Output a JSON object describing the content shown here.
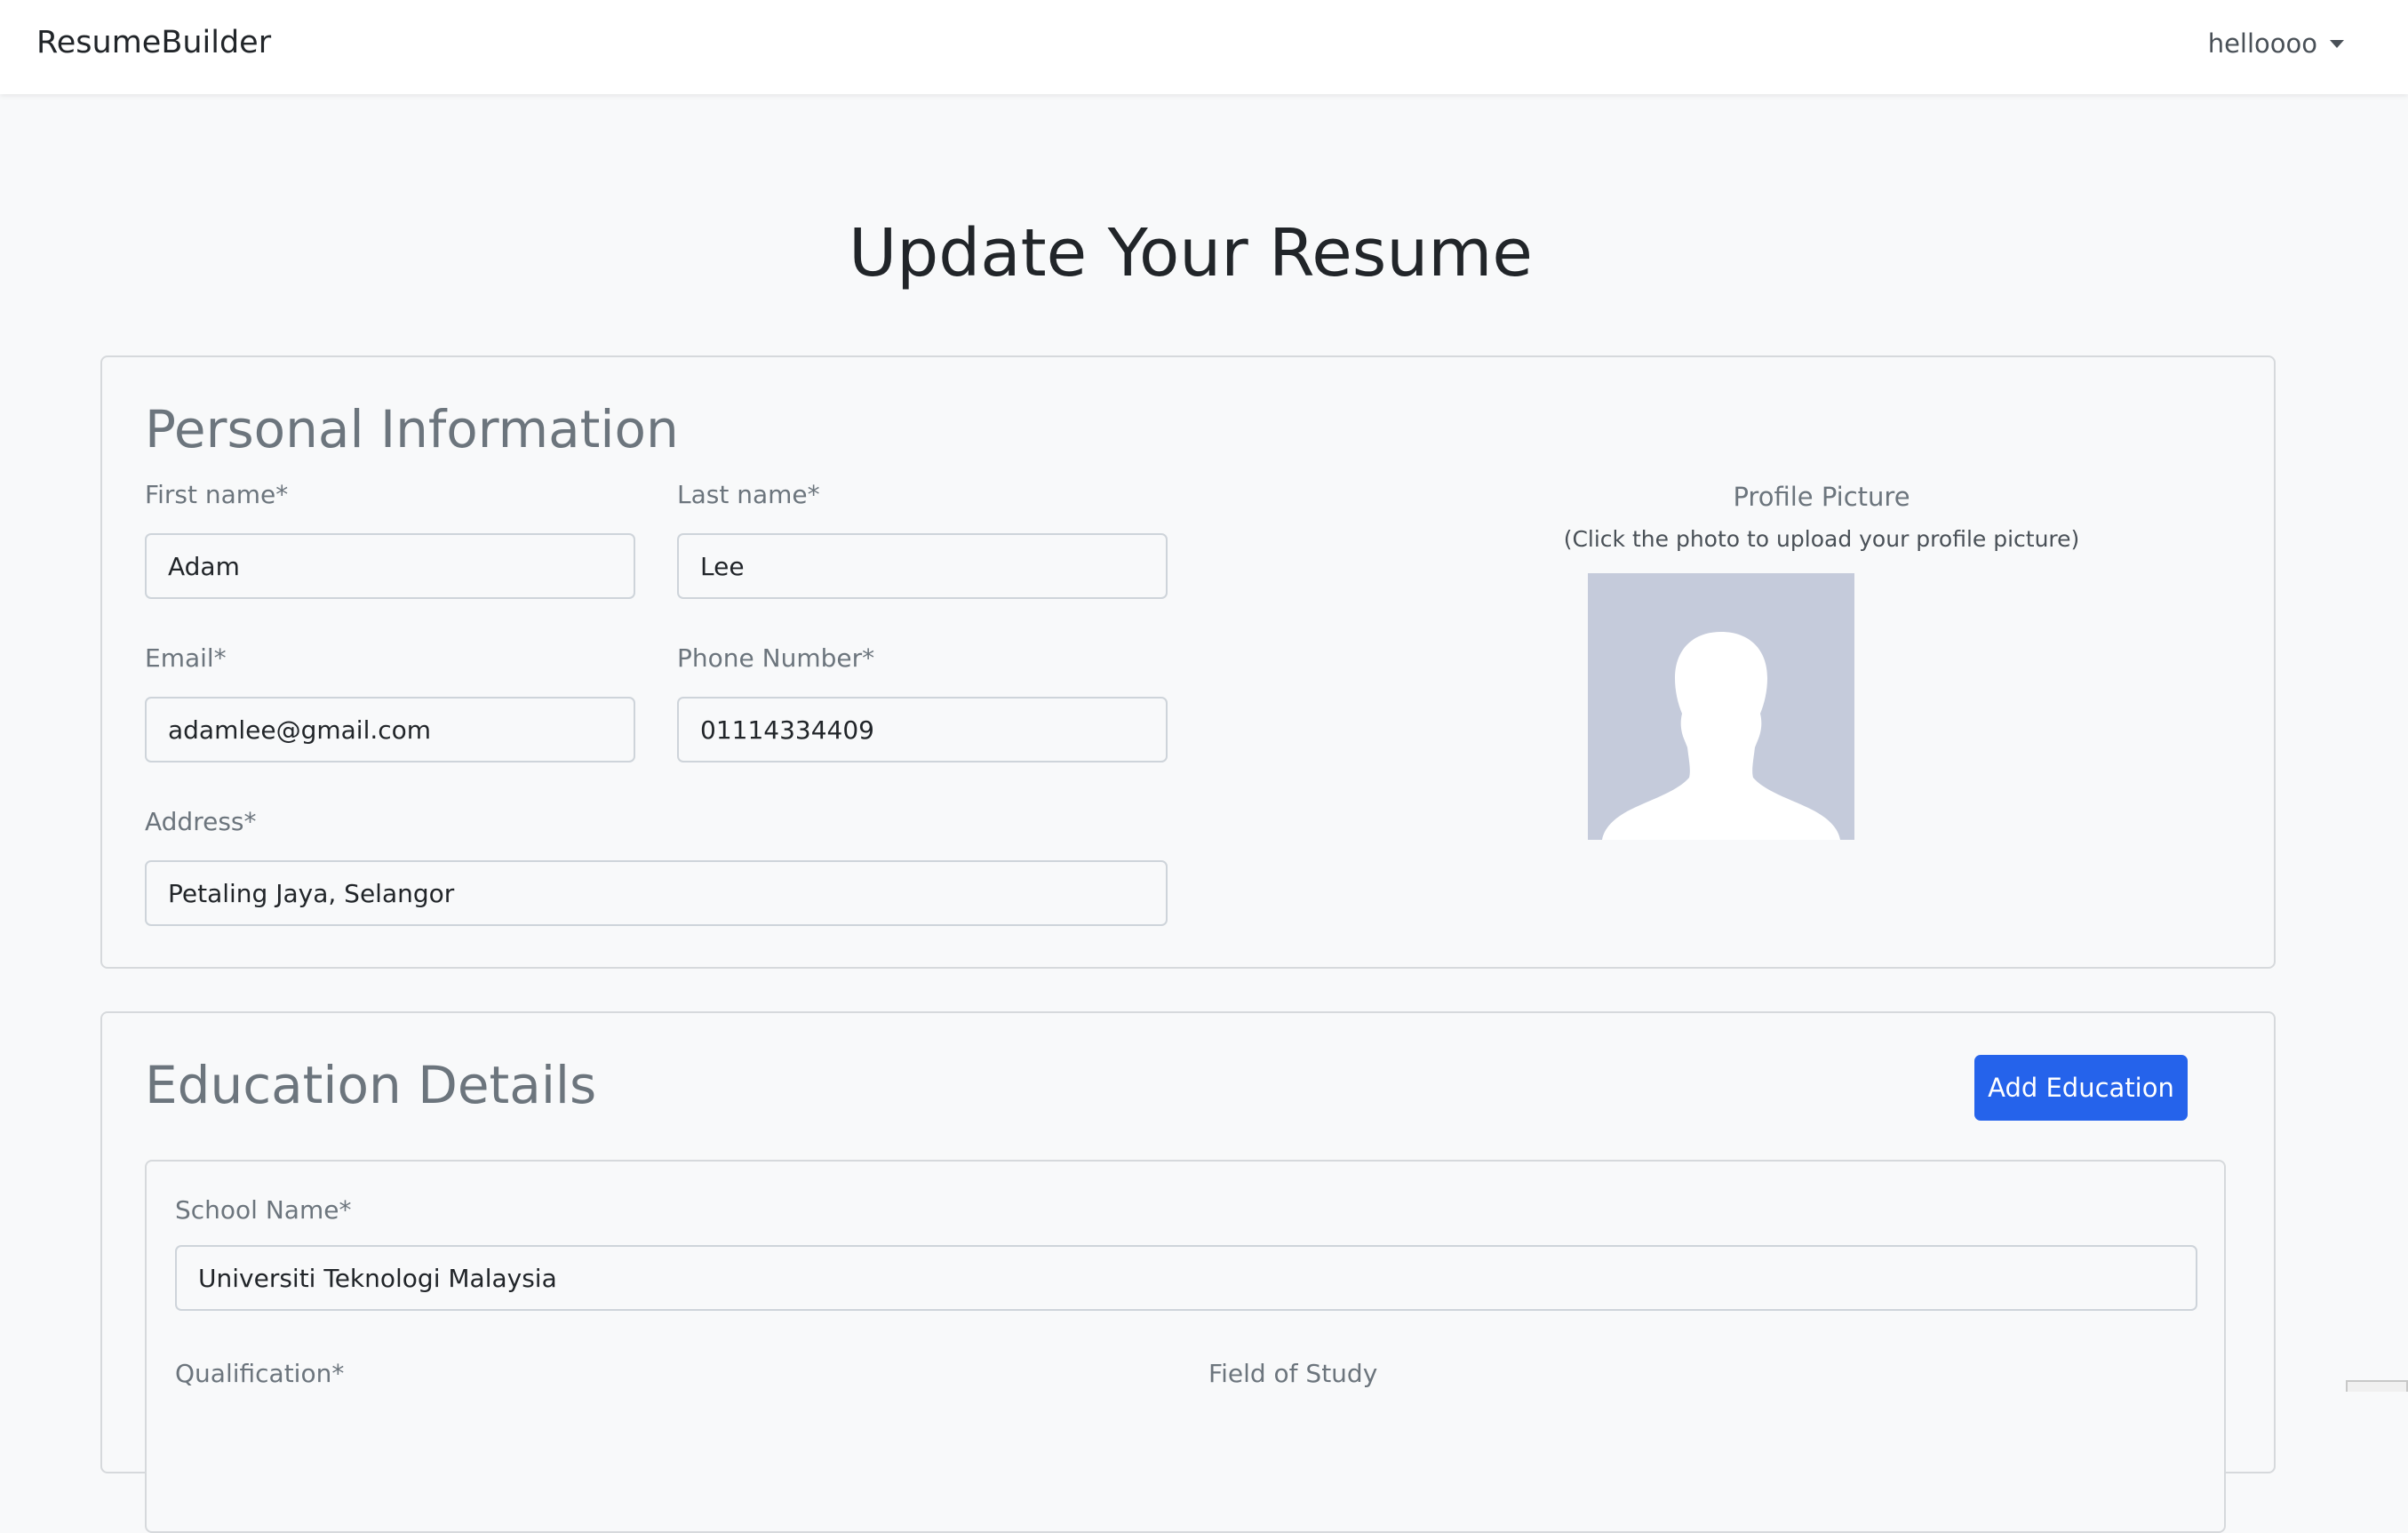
{
  "navbar": {
    "brand": "ResumeBuilder",
    "user_name": "helloooo"
  },
  "page_title": "Update Your Resume",
  "personal": {
    "title": "Personal Information",
    "first_name": {
      "label": "First name*",
      "value": "Adam"
    },
    "last_name": {
      "label": "Last name*",
      "value": "Lee"
    },
    "email": {
      "label": "Email*",
      "value": "adamlee@gmail.com"
    },
    "phone": {
      "label": "Phone Number*",
      "value": "01114334409"
    },
    "address": {
      "label": "Address*",
      "value": "Petaling Jaya, Selangor"
    },
    "profile_picture": {
      "title": "Profile Picture",
      "hint": "(Click the photo to upload your profile picture)"
    }
  },
  "education": {
    "title": "Education Details",
    "add_button": "Add Education",
    "school_name": {
      "label": "School Name*",
      "value": "Universiti Teknologi Malaysia"
    },
    "qualification": {
      "label": "Qualification*"
    },
    "field_of_study": {
      "label": "Field of Study"
    }
  },
  "colors": {
    "primary": "#2563eb",
    "page_bg": "#f8f9fa",
    "muted_text": "#6c757d",
    "avatar_bg": "#c5cbdb"
  }
}
